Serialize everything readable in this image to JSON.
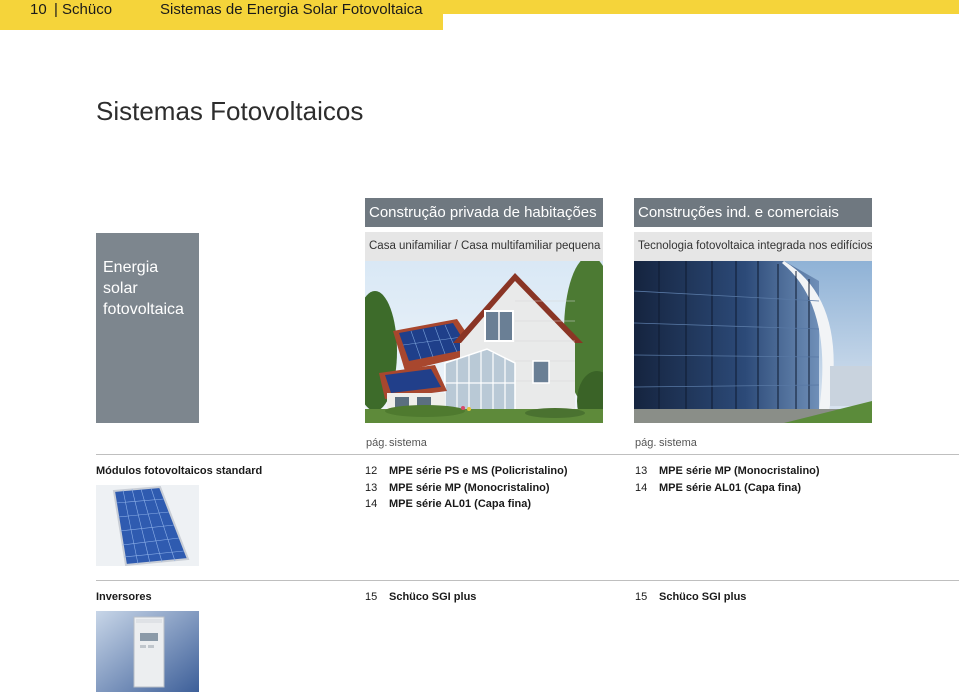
{
  "header": {
    "page_number": "10",
    "separator": "|",
    "brand": "Schüco",
    "running_title": "Sistemas de Energia Solar Fotovoltaica",
    "accent_color": "#f5d43a"
  },
  "page_title": "Sistemas Fotovoltaicos",
  "section_block": {
    "label": "Energia\nsolar\nfotovoltaica",
    "color": "#7d868e"
  },
  "columns": [
    {
      "heading": "Construção privada de habitações",
      "subheading": "Casa unifamiliar / Casa multifamiliar pequena",
      "photo": "house-with-solar-roof-photo",
      "col_label_page": "pág.",
      "col_label_system": "sistema"
    },
    {
      "heading": "Construções ind. e comerciais",
      "subheading": "Tecnologia fotovoltaica integrada nos edifícios",
      "photo": "glass-facade-building-photo",
      "col_label_page": "pág.",
      "col_label_system": "sistema"
    }
  ],
  "rows": [
    {
      "label": "Módulos fotovoltaicos standard",
      "thumbnail": "solar-panel-thumbnail",
      "col1": [
        {
          "page": "12",
          "system": "MPE série PS e MS (Policristalino)"
        },
        {
          "page": "13",
          "system": "MPE série MP (Monocristalino)"
        },
        {
          "page": "14",
          "system": "MPE série AL01 (Capa fina)"
        }
      ],
      "col2": [
        {
          "page": "13",
          "system": "MPE série MP (Monocristalino)"
        },
        {
          "page": "14",
          "system": "MPE série AL01 (Capa fina)"
        }
      ]
    },
    {
      "label": "Inversores",
      "thumbnail": "inverter-thumbnail",
      "col1": [
        {
          "page": "15",
          "system": "Schüco SGI plus"
        }
      ],
      "col2": [
        {
          "page": "15",
          "system": "Schüco SGI plus"
        }
      ]
    }
  ]
}
